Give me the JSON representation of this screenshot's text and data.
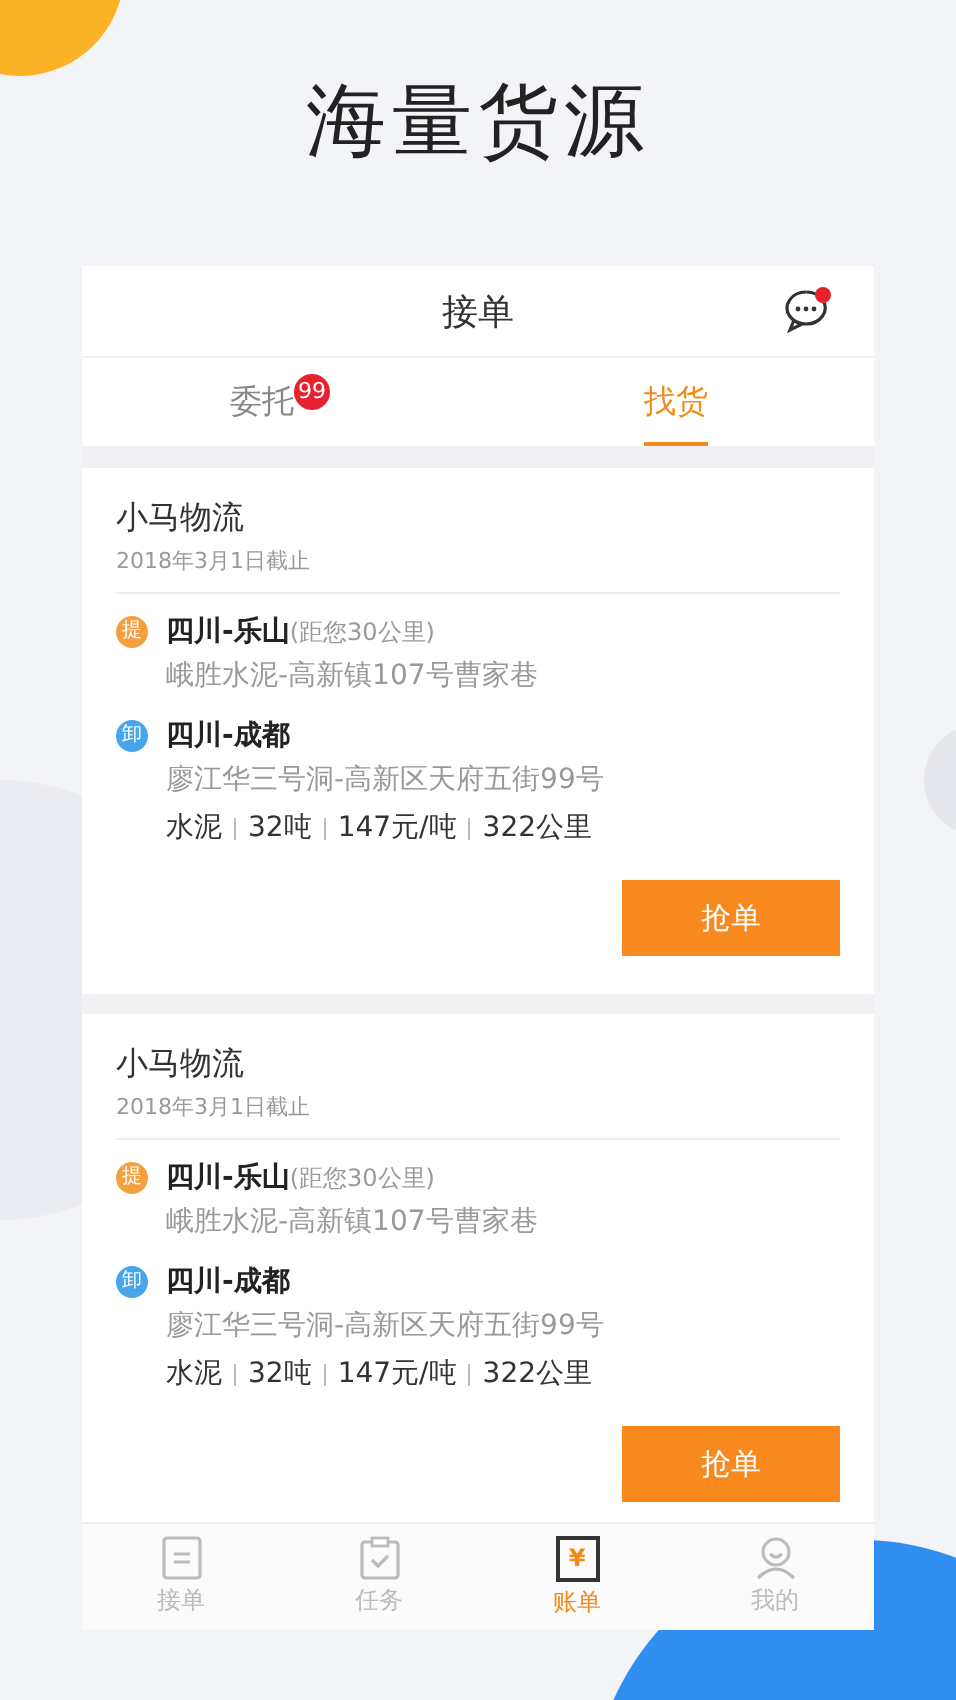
{
  "headline": "海量货源",
  "header": {
    "title": "接单",
    "has_unread": true
  },
  "tabs": [
    {
      "label": "委托",
      "badge": "99",
      "selected": false
    },
    {
      "label": "找货",
      "selected": true
    }
  ],
  "orders": [
    {
      "company": "小马物流",
      "deadline": "2018年3月1日截止",
      "stops": [
        {
          "kind": "pickup",
          "badge": "提",
          "place": "四川-乐山",
          "distance": "(距您30公里)",
          "address": "峨胜水泥-高新镇107号曹家巷"
        },
        {
          "kind": "drop",
          "badge": "卸",
          "place": "四川-成都",
          "address": "廖江华三号洞-高新区天府五街99号"
        }
      ],
      "details": [
        "水泥",
        "32吨",
        "147元/吨",
        "322公里"
      ],
      "button": "抢单"
    },
    {
      "company": "小马物流",
      "deadline": "2018年3月1日截止",
      "stops": [
        {
          "kind": "pickup",
          "badge": "提",
          "place": "四川-乐山",
          "distance": "(距您30公里)",
          "address": "峨胜水泥-高新镇107号曹家巷"
        },
        {
          "kind": "drop",
          "badge": "卸",
          "place": "四川-成都",
          "address": "廖江华三号洞-高新区天府五街99号"
        }
      ],
      "details": [
        "水泥",
        "32吨",
        "147元/吨",
        "322公里"
      ],
      "button": "抢单"
    }
  ],
  "nav": [
    {
      "kind": "list",
      "label": "接单",
      "selected": false
    },
    {
      "kind": "clipboard",
      "label": "任务",
      "selected": false
    },
    {
      "kind": "bill",
      "label": "账单",
      "glyph": "¥",
      "selected": true
    },
    {
      "kind": "profile",
      "label": "我的",
      "selected": false
    }
  ]
}
